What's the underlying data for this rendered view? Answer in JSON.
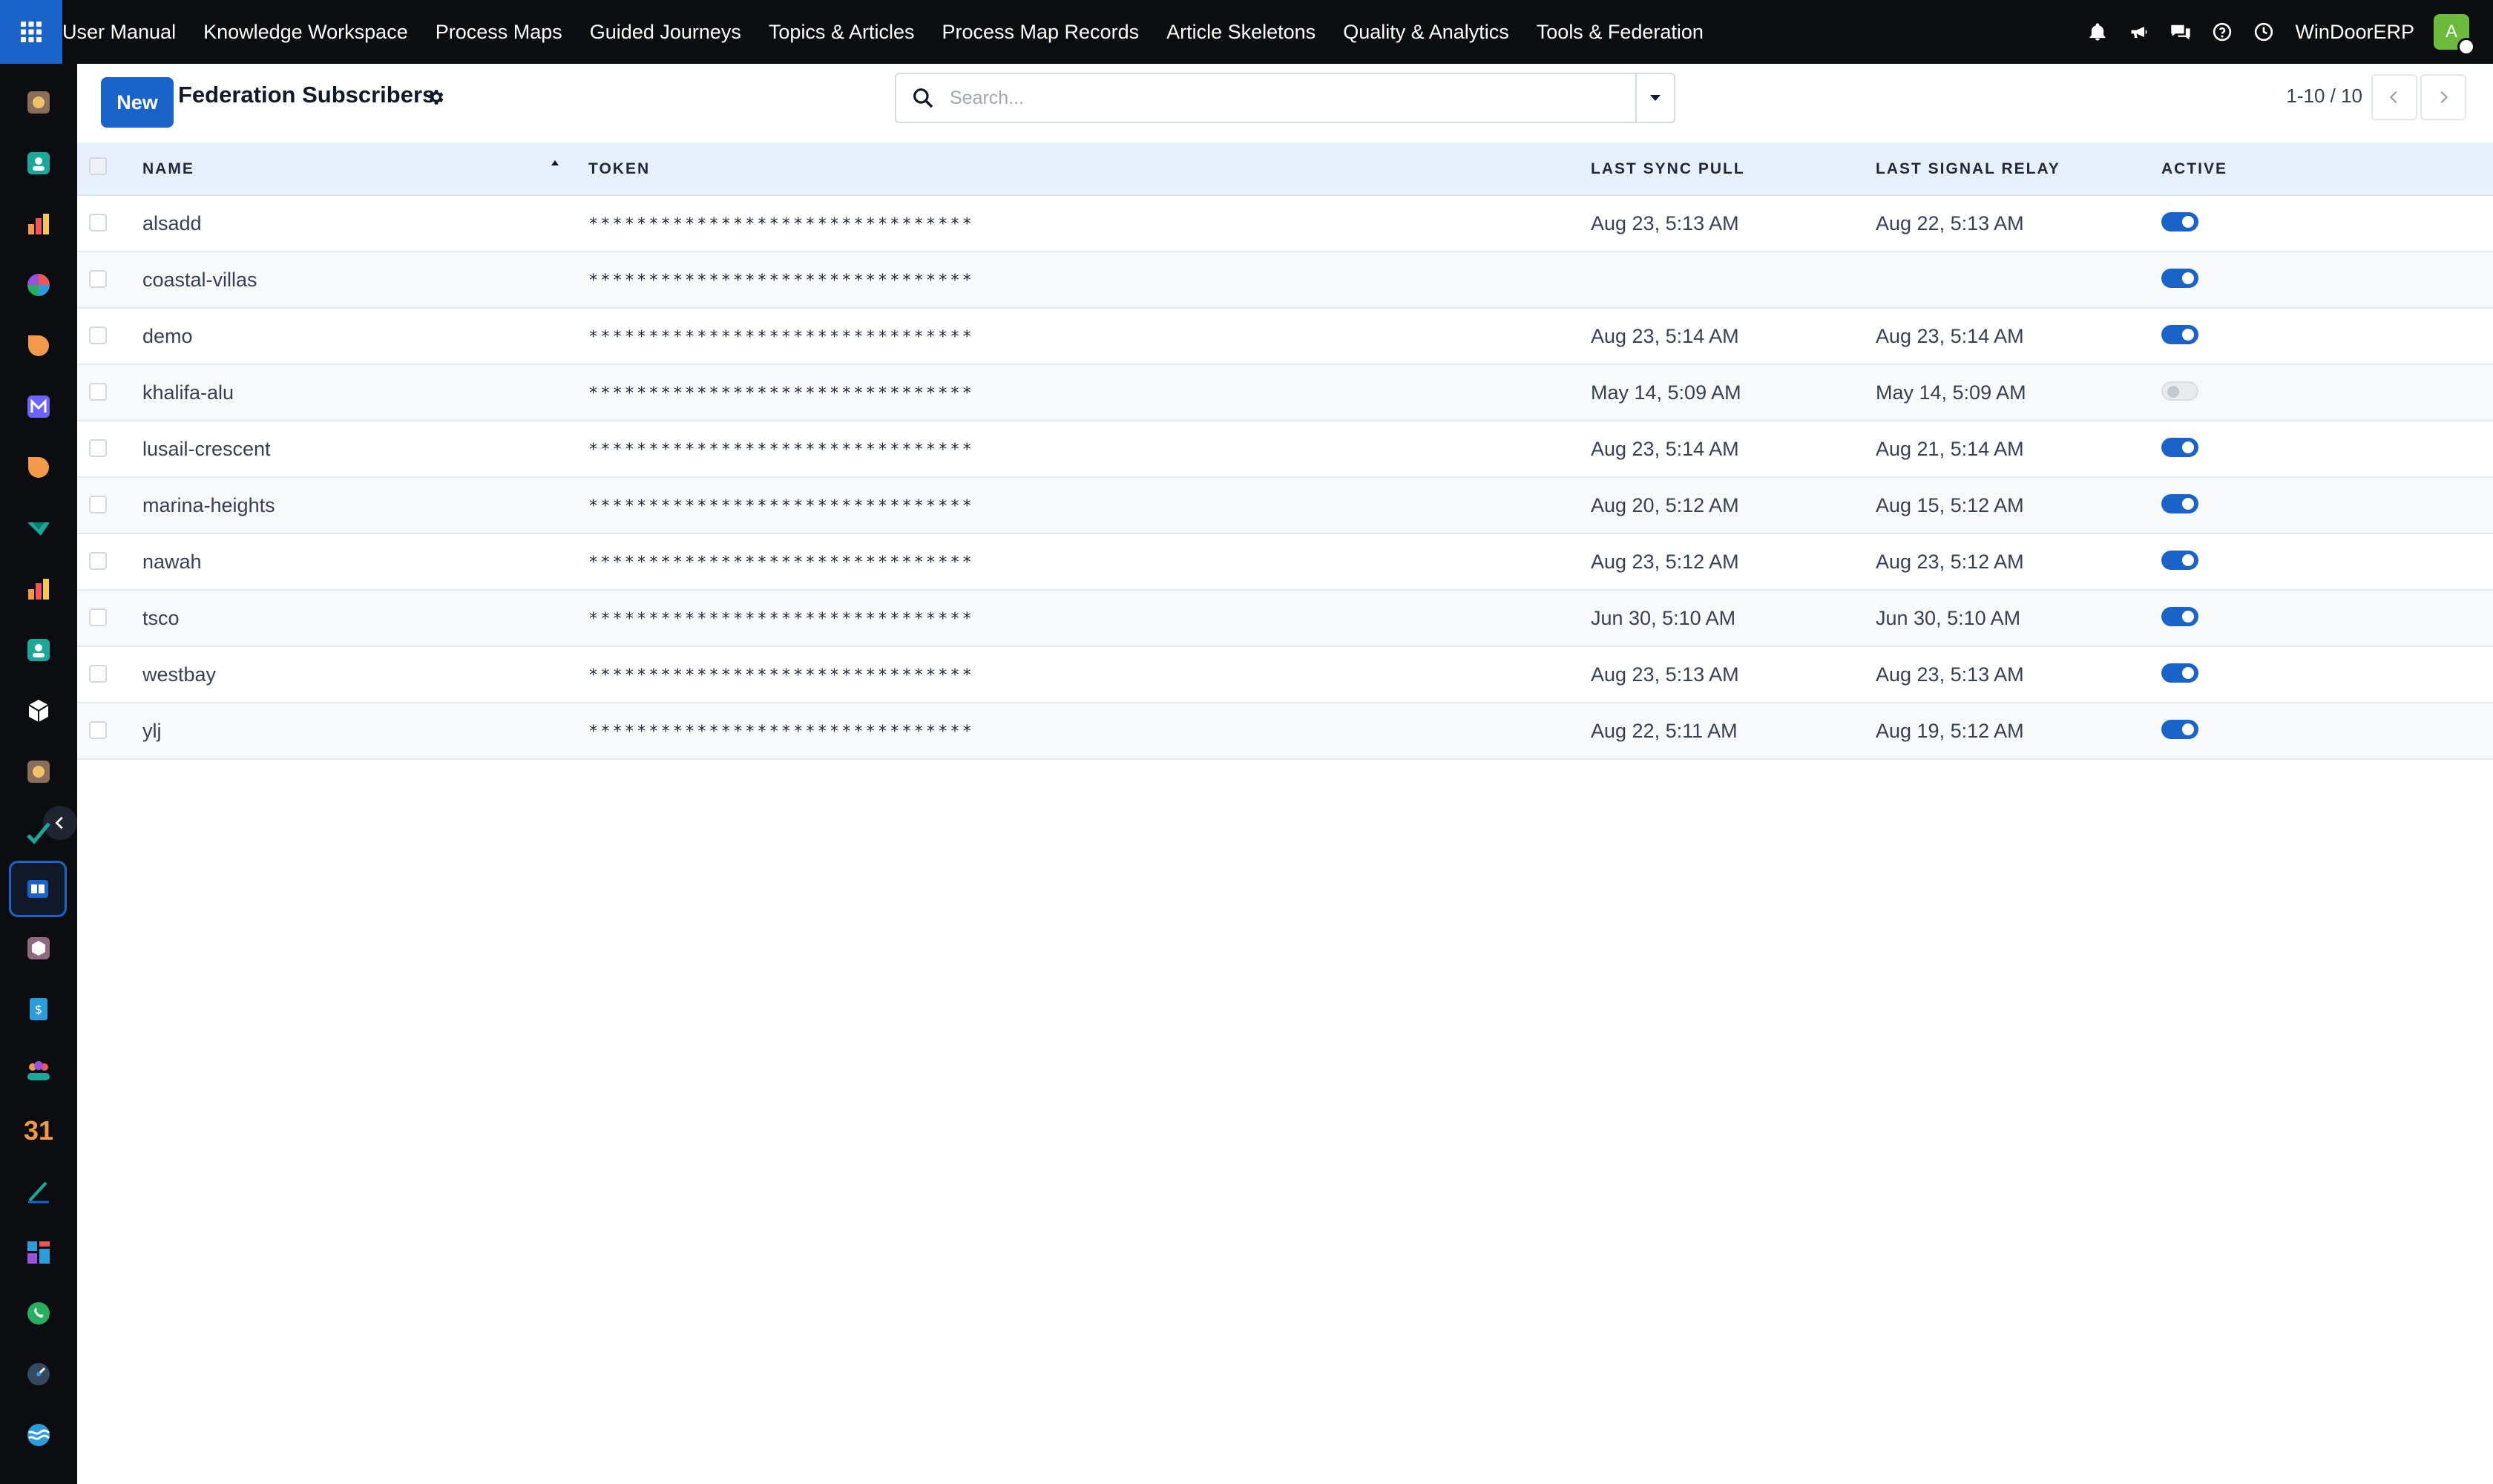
{
  "topbar": {
    "menu": [
      "User Manual",
      "Knowledge Workspace",
      "Process Maps",
      "Guided Journeys",
      "Topics & Articles",
      "Process Map Records",
      "Article Skeletons",
      "Quality & Analytics",
      "Tools & Federation"
    ],
    "company": "WinDoorERP",
    "avatar_initial": "A",
    "icons": [
      "bell-icon",
      "megaphone-icon",
      "chat-icon",
      "help-icon",
      "activity-icon"
    ]
  },
  "sidebar": {
    "apps": [
      "app-1",
      "app-2",
      "app-3",
      "app-4",
      "app-5",
      "app-6",
      "app-7",
      "app-8",
      "app-9",
      "app-10",
      "app-11",
      "app-12",
      "app-13",
      "knowledge-app",
      "app-15",
      "app-16",
      "app-17",
      "calendar-app",
      "app-19",
      "app-20",
      "whatsapp-app",
      "app-22",
      "app-23"
    ],
    "calendar_label": "31"
  },
  "controls": {
    "new_label": "New",
    "title": "Federation Subscribers",
    "search_placeholder": "Search...",
    "pager_text": "1-10 / 10"
  },
  "table": {
    "headers": {
      "name": "NAME",
      "token": "TOKEN",
      "last_sync_pull": "LAST SYNC PULL",
      "last_signal_relay": "LAST SIGNAL RELAY",
      "active": "ACTIVE"
    },
    "rows": [
      {
        "name": "alsadd",
        "token": "********************************",
        "last_sync_pull": "Aug 23, 5:13 AM",
        "last_signal_relay": "Aug 22, 5:13 AM",
        "active": true
      },
      {
        "name": "coastal-villas",
        "token": "********************************",
        "last_sync_pull": "",
        "last_signal_relay": "",
        "active": true
      },
      {
        "name": "demo",
        "token": "********************************",
        "last_sync_pull": "Aug 23, 5:14 AM",
        "last_signal_relay": "Aug 23, 5:14 AM",
        "active": true
      },
      {
        "name": "khalifa-alu",
        "token": "********************************",
        "last_sync_pull": "May 14, 5:09 AM",
        "last_signal_relay": "May 14, 5:09 AM",
        "active": false
      },
      {
        "name": "lusail-crescent",
        "token": "********************************",
        "last_sync_pull": "Aug 23, 5:14 AM",
        "last_signal_relay": "Aug 21, 5:14 AM",
        "active": true
      },
      {
        "name": "marina-heights",
        "token": "********************************",
        "last_sync_pull": "Aug 20, 5:12 AM",
        "last_signal_relay": "Aug 15, 5:12 AM",
        "active": true
      },
      {
        "name": "nawah",
        "token": "********************************",
        "last_sync_pull": "Aug 23, 5:12 AM",
        "last_signal_relay": "Aug 23, 5:12 AM",
        "active": true
      },
      {
        "name": "tsco",
        "token": "********************************",
        "last_sync_pull": "Jun 30, 5:10 AM",
        "last_signal_relay": "Jun 30, 5:10 AM",
        "active": true
      },
      {
        "name": "westbay",
        "token": "********************************",
        "last_sync_pull": "Aug 23, 5:13 AM",
        "last_signal_relay": "Aug 23, 5:13 AM",
        "active": true
      },
      {
        "name": "ylj",
        "token": "********************************",
        "last_sync_pull": "Aug 22, 5:11 AM",
        "last_signal_relay": "Aug 19, 5:12 AM",
        "active": true
      }
    ]
  },
  "colors": {
    "brand": "#1a64c9",
    "topbar_bg": "#0b0d11",
    "header_bg": "#e7f0fc",
    "avatar_bg": "#6cba3c"
  }
}
